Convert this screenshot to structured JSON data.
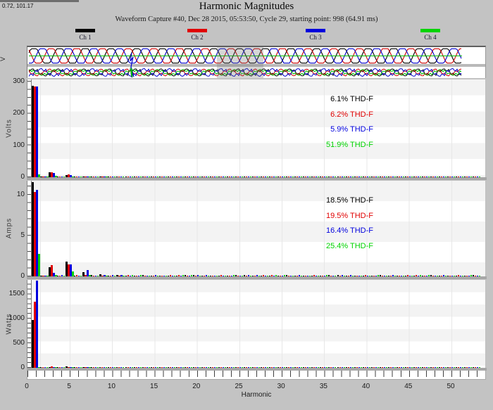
{
  "header": {
    "cursor_readout": "0.72, 101.17",
    "title": "Harmonic Magnitudes",
    "subtitle": "Waveform Capture #40, Dec 28 2015, 05:53:50, Cycle 29,  starting point: 998  (64.91 ms)"
  },
  "legend": {
    "channels": [
      {
        "label": "Ch 1",
        "color": "#000000"
      },
      {
        "label": "Ch 2",
        "color": "#e00000"
      },
      {
        "label": "Ch 3",
        "color": "#0000dd"
      },
      {
        "label": "Ch 4",
        "color": "#00d300"
      }
    ]
  },
  "waveform": {
    "axis_label": "V",
    "selected_region": "cycle 29 highlight"
  },
  "chart_data": [
    {
      "type": "bar",
      "ylabel": "Volts",
      "yticks": [
        0,
        100,
        200,
        300
      ],
      "ymax": 307,
      "minor_tick_step": 25,
      "harmonics": {
        "1": [
          287,
          285,
          284,
          9
        ],
        "2": [
          2,
          2,
          2,
          1.5
        ],
        "3": [
          15,
          16,
          14,
          4
        ],
        "5": [
          7,
          8,
          7,
          3
        ],
        "7": [
          3,
          2,
          2,
          2
        ],
        "9": [
          2,
          1.5,
          1.5,
          1.5
        ]
      },
      "noise_floor_frac": 0.008,
      "thd_f": [
        "6.1% THD-F",
        "6.2% THD-F",
        "5.9% THD-F",
        "51.9% THD-F"
      ]
    },
    {
      "type": "bar",
      "ylabel": "Amps",
      "yticks": [
        0,
        5,
        10
      ],
      "ymax": 11.7,
      "minor_tick_step": 1,
      "harmonics": {
        "1": [
          11.5,
          10.3,
          10.6,
          2.8
        ],
        "2": [
          0.12,
          0.12,
          0.12,
          0.1
        ],
        "3": [
          1.1,
          1.4,
          0.4,
          0.2
        ],
        "5": [
          1.8,
          1.5,
          1.5,
          0.6
        ],
        "7": [
          0.5,
          0.2,
          0.75,
          0.15
        ],
        "9": [
          0.25,
          0.12,
          0.2,
          0.1
        ],
        "11": [
          0.15,
          0.1,
          0.15,
          0.1
        ]
      },
      "noise_floor_frac": 0.012,
      "thd_f": [
        "18.5% THD-F",
        "19.5% THD-F",
        "16.4% THD-F",
        "25.4% THD-F"
      ]
    },
    {
      "type": "bar",
      "ylabel": "Watts",
      "yticks": [
        0,
        500,
        1000,
        1500
      ],
      "ymax": 1790,
      "minor_tick_step": 100,
      "harmonics": {
        "1": [
          980,
          1340,
          1780,
          15
        ],
        "3": [
          8,
          30,
          6,
          4
        ],
        "5": [
          25,
          12,
          20,
          4
        ],
        "7": [
          6,
          5,
          8,
          3
        ]
      },
      "noise_floor_frac": 0.009,
      "thd_f": []
    }
  ],
  "xaxis": {
    "label": "Harmonic",
    "ticks": [
      0,
      5,
      10,
      15,
      20,
      25,
      30,
      35,
      40,
      45,
      50
    ],
    "max_harmonic": 53
  }
}
